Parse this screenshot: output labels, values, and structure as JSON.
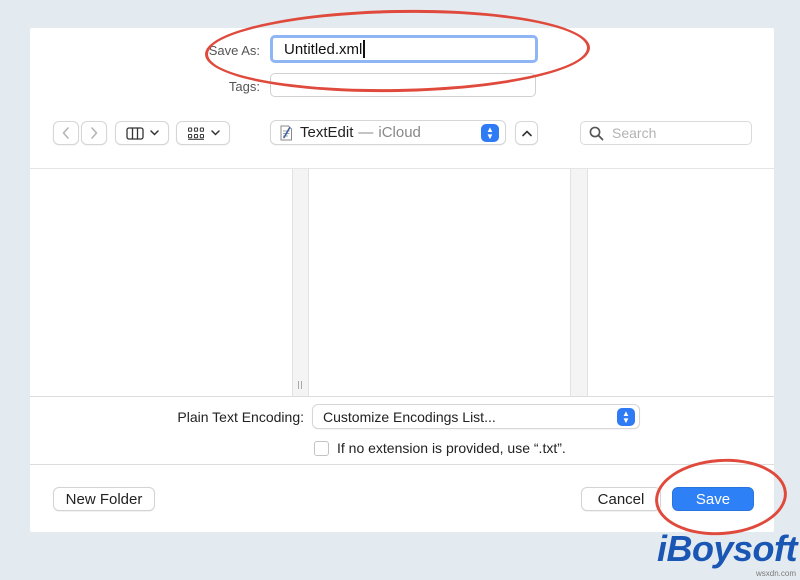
{
  "save_dialog": {
    "save_as_label": "Save As:",
    "filename_value": "Untitled.xml",
    "tags_label": "Tags:",
    "tags_value": "",
    "location": {
      "name": "TextEdit",
      "separator": "—",
      "sub": "iCloud"
    },
    "search_placeholder": "Search",
    "encoding_label": "Plain Text Encoding:",
    "encoding_value": "Customize Encodings List...",
    "extension_checkbox_label": "If no extension is provided, use “.txt”.",
    "extension_checked": false,
    "new_folder_label": "New Folder",
    "cancel_label": "Cancel",
    "save_label": "Save"
  },
  "icons": {
    "back": "chevron-left-icon",
    "forward": "chevron-right-icon",
    "column_view": "column-view-icon",
    "grid_view": "grid-view-icon",
    "document": "document-icon",
    "search": "magnifier-icon"
  },
  "colors": {
    "accent": "#2e80f6",
    "annotation": "#df4a3c",
    "brand": "#1a56b3",
    "background": "#e4ebf0"
  },
  "branding": {
    "logo_text": "iBoysoft",
    "watermark": "wsxdn.com"
  }
}
